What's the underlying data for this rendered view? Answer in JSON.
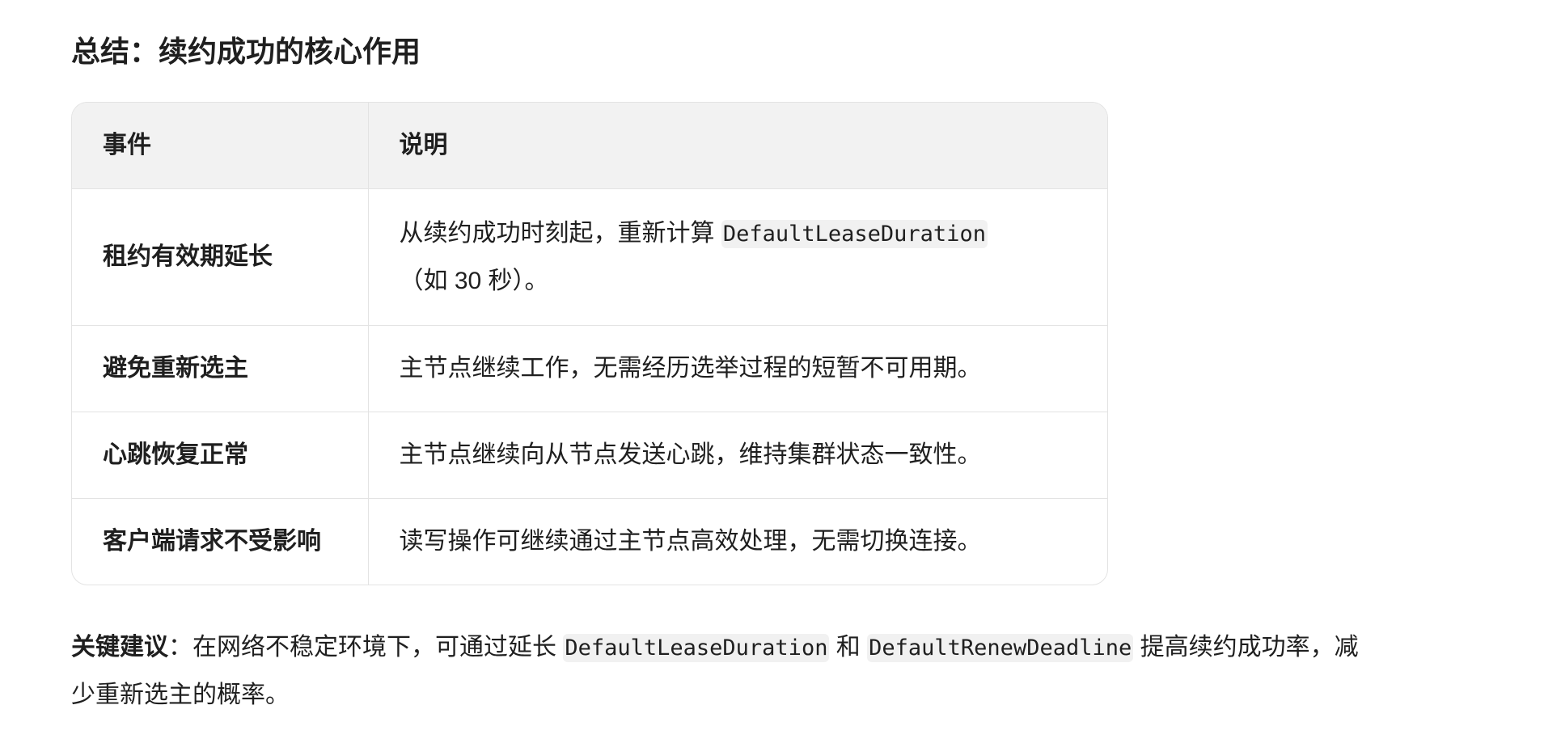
{
  "section": {
    "title": "总结：续约成功的核心作用"
  },
  "table": {
    "headers": [
      "事件",
      "说明"
    ],
    "rows": [
      {
        "event": "租约有效期延长",
        "desc_before": "从续约成功时刻起，重新计算 ",
        "desc_code": "DefaultLeaseDuration",
        "desc_after": "（如 30 秒）。"
      },
      {
        "event": "避免重新选主",
        "desc": "主节点继续工作，无需经历选举过程的短暂不可用期。"
      },
      {
        "event": "心跳恢复正常",
        "desc": "主节点继续向从节点发送心跳，维持集群状态一致性。"
      },
      {
        "event": "客户端请求不受影响",
        "desc": "读写操作可继续通过主节点高效处理，无需切换连接。"
      }
    ]
  },
  "advice": {
    "label": "关键建议",
    "colon": "：",
    "text1": "在网络不稳定环境下，可通过延长 ",
    "code1": "DefaultLeaseDuration",
    "text2": " 和 ",
    "code2": "DefaultRenewDeadline",
    "text3": " 提高续约成功率，减少重新选主的概率。"
  }
}
